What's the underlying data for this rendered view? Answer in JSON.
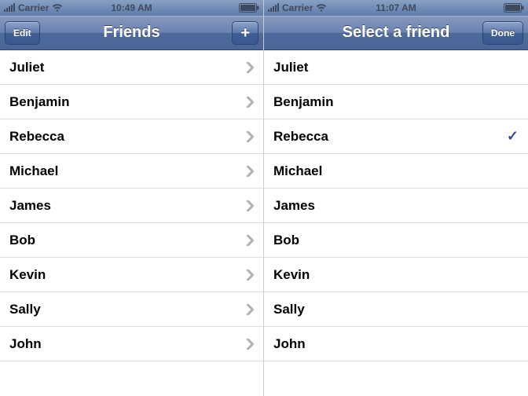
{
  "screens": [
    {
      "status": {
        "carrier": "Carrier",
        "time": "10:49 AM"
      },
      "nav": {
        "title": "Friends",
        "left_label": "Edit",
        "right_type": "plus"
      },
      "row_accessory": "disclosure",
      "friends": [
        "Juliet",
        "Benjamin",
        "Rebecca",
        "Michael",
        "James",
        "Bob",
        "Kevin",
        "Sally",
        "John"
      ],
      "selected": null
    },
    {
      "status": {
        "carrier": "Carrier",
        "time": "11:07 AM"
      },
      "nav": {
        "title": "Select a friend",
        "left_label": null,
        "right_type": "done",
        "right_label": "Done"
      },
      "row_accessory": "checkmark",
      "friends": [
        "Juliet",
        "Benjamin",
        "Rebecca",
        "Michael",
        "James",
        "Bob",
        "Kevin",
        "Sally",
        "John"
      ],
      "selected": "Rebecca"
    }
  ]
}
